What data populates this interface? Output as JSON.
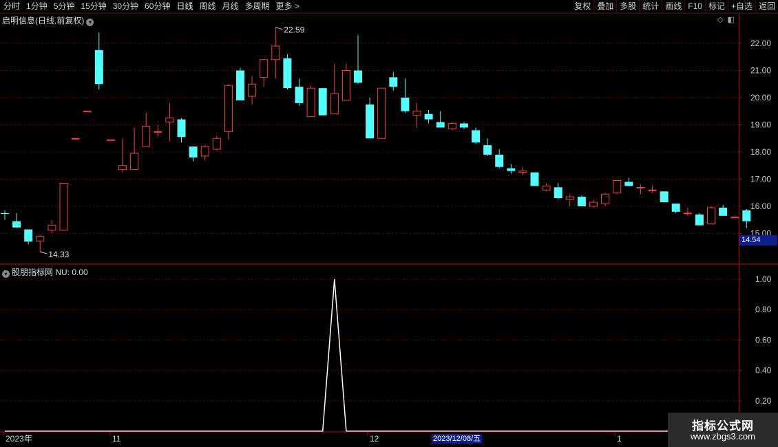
{
  "toolbar": {
    "periods": [
      "分时",
      "1分钟",
      "5分钟",
      "15分钟",
      "30分钟",
      "60分钟",
      "日线",
      "周线",
      "月线",
      "多周期",
      "更多 >"
    ],
    "active_period": "日线",
    "actions": [
      "复权",
      "叠加",
      "多股",
      "统计",
      "画线",
      "F10",
      "标记",
      "+自选",
      "返回"
    ]
  },
  "main_panel": {
    "title": "启明信息(日线,前复权)",
    "price_ticks": [
      "22.00",
      "21.00",
      "20.00",
      "19.00",
      "18.00",
      "17.00",
      "16.00",
      "15.00"
    ],
    "high_label": "22.59",
    "low_label": "14.33",
    "current_price": "14.54"
  },
  "indicator_panel": {
    "title": "股朋指标网 NU: 0.00",
    "ticks": [
      "1.00",
      "0.80",
      "0.60",
      "0.40",
      "0.20"
    ]
  },
  "time_axis": {
    "labels": [
      "2023年",
      "11",
      "12",
      "1"
    ],
    "cursor_date": "2023/12/08/五"
  },
  "watermark": {
    "line1": "指标公式网",
    "line2": "www.zbgs3.com"
  },
  "colors": {
    "up": "#ff3c3c",
    "down": "#54fcfc",
    "grid": "#7a0000",
    "axis": "#b01010",
    "current_price_bg": "#0f1e8c"
  },
  "chart_data": {
    "type": "candlestick",
    "ohlc": [
      [
        15.75,
        15.85,
        15.5,
        15.72
      ],
      [
        15.45,
        15.75,
        15.2,
        15.22
      ],
      [
        15.15,
        15.15,
        14.6,
        14.7
      ],
      [
        14.72,
        14.95,
        14.33,
        14.9
      ],
      [
        15.12,
        15.5,
        15.0,
        15.3
      ],
      [
        15.12,
        16.85,
        15.1,
        16.85
      ],
      [
        18.5,
        18.5,
        18.5,
        18.5
      ],
      [
        19.5,
        19.5,
        19.5,
        19.5
      ],
      [
        21.75,
        22.4,
        20.3,
        20.5
      ],
      [
        18.45,
        18.45,
        18.45,
        18.45
      ],
      [
        17.35,
        18.5,
        17.25,
        17.5
      ],
      [
        17.35,
        18.9,
        17.35,
        17.95
      ],
      [
        18.2,
        19.45,
        18.2,
        18.95
      ],
      [
        18.75,
        19.0,
        18.55,
        18.75
      ],
      [
        19.1,
        19.8,
        18.4,
        19.25
      ],
      [
        19.2,
        19.25,
        18.35,
        18.55
      ],
      [
        18.2,
        18.2,
        17.65,
        17.8
      ],
      [
        17.85,
        18.25,
        17.7,
        18.2
      ],
      [
        18.1,
        18.6,
        18.05,
        18.5
      ],
      [
        18.75,
        20.5,
        18.45,
        20.45
      ],
      [
        21.0,
        21.1,
        19.9,
        19.9
      ],
      [
        20.05,
        20.8,
        19.75,
        20.5
      ],
      [
        20.75,
        21.4,
        20.4,
        21.4
      ],
      [
        21.4,
        22.59,
        20.7,
        21.9
      ],
      [
        21.45,
        21.6,
        20.3,
        20.35
      ],
      [
        20.4,
        20.7,
        19.7,
        19.8
      ],
      [
        19.3,
        20.45,
        19.3,
        20.35
      ],
      [
        20.35,
        20.35,
        19.35,
        19.35
      ],
      [
        19.4,
        21.25,
        19.4,
        20.15
      ],
      [
        19.9,
        21.25,
        19.9,
        21.0
      ],
      [
        21.0,
        22.3,
        20.5,
        20.55
      ],
      [
        19.75,
        20.0,
        18.5,
        18.5
      ],
      [
        18.5,
        20.35,
        18.5,
        20.35
      ],
      [
        20.75,
        20.95,
        20.25,
        20.4
      ],
      [
        20.0,
        20.7,
        19.45,
        19.5
      ],
      [
        19.35,
        19.8,
        18.9,
        19.5
      ],
      [
        19.4,
        19.55,
        19.05,
        19.2
      ],
      [
        19.1,
        19.5,
        18.95,
        18.9
      ],
      [
        18.85,
        19.1,
        18.8,
        19.05
      ],
      [
        19.05,
        19.1,
        18.85,
        18.9
      ],
      [
        18.8,
        18.9,
        18.3,
        18.35
      ],
      [
        18.25,
        18.5,
        17.85,
        17.9
      ],
      [
        17.9,
        18.1,
        17.4,
        17.45
      ],
      [
        17.4,
        17.55,
        17.2,
        17.3
      ],
      [
        17.25,
        17.45,
        17.15,
        17.3
      ],
      [
        17.25,
        17.25,
        16.75,
        16.75
      ],
      [
        16.6,
        16.85,
        16.55,
        16.75
      ],
      [
        16.7,
        16.85,
        16.25,
        16.3
      ],
      [
        16.25,
        16.45,
        16.0,
        16.35
      ],
      [
        16.35,
        16.4,
        16.0,
        16.0
      ],
      [
        16.0,
        16.25,
        15.95,
        16.15
      ],
      [
        16.1,
        16.5,
        16.0,
        16.45
      ],
      [
        16.5,
        16.95,
        16.45,
        16.95
      ],
      [
        16.9,
        17.05,
        16.75,
        16.75
      ],
      [
        16.7,
        16.8,
        16.45,
        16.7
      ],
      [
        16.6,
        16.75,
        16.5,
        16.6
      ],
      [
        16.55,
        16.55,
        16.15,
        16.15
      ],
      [
        16.1,
        16.1,
        15.75,
        15.8
      ],
      [
        15.75,
        15.95,
        15.65,
        15.75
      ],
      [
        15.7,
        15.75,
        15.3,
        15.3
      ],
      [
        15.35,
        16.0,
        15.35,
        15.95
      ],
      [
        15.95,
        16.05,
        15.65,
        15.65
      ],
      [
        15.6,
        15.65,
        15.6,
        15.6
      ],
      [
        15.85,
        15.9,
        15.2,
        15.45
      ]
    ],
    "indicator": {
      "name": "NU",
      "values": [
        0,
        0,
        0,
        0,
        0,
        0,
        0,
        0,
        0,
        0,
        0,
        0,
        0,
        0,
        0,
        0,
        0,
        0,
        0,
        0,
        0,
        0,
        0,
        0,
        0,
        0,
        0,
        0,
        1,
        0,
        0,
        0,
        0,
        0,
        0,
        0,
        0,
        0,
        0,
        0,
        0,
        0,
        0,
        0,
        0,
        0,
        0,
        0,
        0,
        0,
        0,
        0,
        0,
        0,
        0,
        0,
        0,
        0,
        0,
        0,
        0,
        0,
        0,
        0
      ],
      "ylim": [
        0,
        1
      ]
    }
  }
}
